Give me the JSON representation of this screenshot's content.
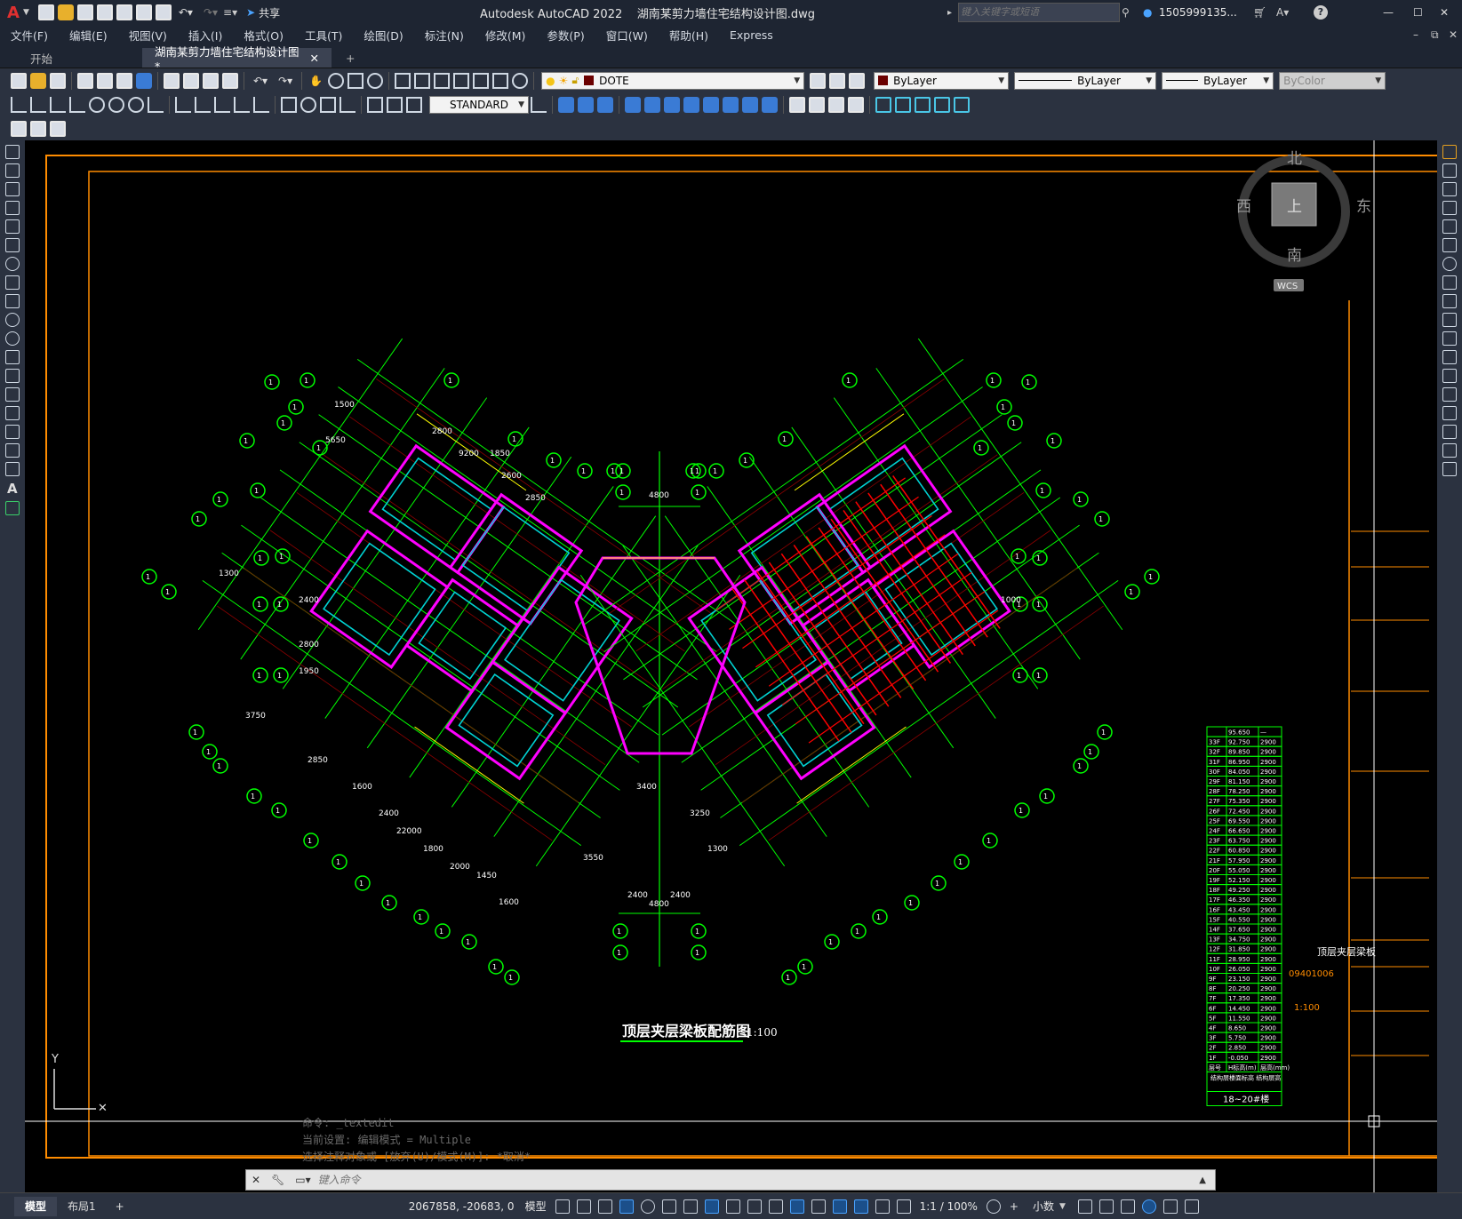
{
  "titlebar": {
    "app_menu": "A",
    "share_label": "共享",
    "title": "Autodesk AutoCAD 2022    湖南某剪力墙住宅结构设计图.dwg",
    "search_placeholder": "键入关键字或短语",
    "user": "1505999135...",
    "help": "?"
  },
  "menu": [
    "文件(F)",
    "编辑(E)",
    "视图(V)",
    "插入(I)",
    "格式(O)",
    "工具(T)",
    "绘图(D)",
    "标注(N)",
    "修改(M)",
    "参数(P)",
    "窗口(W)",
    "帮助(H)",
    "Express"
  ],
  "tabs": [
    {
      "label": "开始",
      "active": false
    },
    {
      "label": "湖南某剪力墙住宅结构设计图*",
      "active": true
    }
  ],
  "toolbar": {
    "layer_name": "DOTE",
    "color": "ByLayer",
    "linetype": "ByLayer",
    "lineweight": "ByLayer",
    "plotstyle": "ByColor",
    "dimstyle": "STANDARD"
  },
  "viewcube": {
    "north": "北",
    "south": "南",
    "east": "东",
    "west": "西",
    "top": "上",
    "wcs": "WCS"
  },
  "drawing": {
    "title": "顶层夹层梁板配筋图",
    "scale": "1:100",
    "dims": [
      "4800",
      "4800",
      "2400",
      "2400",
      "2400",
      "2800",
      "1950",
      "2800",
      "9200",
      "1850",
      "2600",
      "2850",
      "5650",
      "1300",
      "1500",
      "3750",
      "2850",
      "1600",
      "2400",
      "22000",
      "1800",
      "2000",
      "1450",
      "1600",
      "3550",
      "3400",
      "3250",
      "1300",
      "1000"
    ],
    "level_table_title": "结构层楼面标高 结构层高",
    "level_table_footer": "18~20#楼",
    "levels": [
      [
        "",
        "95.650",
        "—"
      ],
      [
        "33F",
        "92.750",
        "2900"
      ],
      [
        "32F",
        "89.850",
        "2900"
      ],
      [
        "31F",
        "86.950",
        "2900"
      ],
      [
        "30F",
        "84.050",
        "2900"
      ],
      [
        "29F",
        "81.150",
        "2900"
      ],
      [
        "28F",
        "78.250",
        "2900"
      ],
      [
        "27F",
        "75.350",
        "2900"
      ],
      [
        "26F",
        "72.450",
        "2900"
      ],
      [
        "25F",
        "69.550",
        "2900"
      ],
      [
        "24F",
        "66.650",
        "2900"
      ],
      [
        "23F",
        "63.750",
        "2900"
      ],
      [
        "22F",
        "60.850",
        "2900"
      ],
      [
        "21F",
        "57.950",
        "2900"
      ],
      [
        "20F",
        "55.050",
        "2900"
      ],
      [
        "19F",
        "52.150",
        "2900"
      ],
      [
        "18F",
        "49.250",
        "2900"
      ],
      [
        "17F",
        "46.350",
        "2900"
      ],
      [
        "16F",
        "43.450",
        "2900"
      ],
      [
        "15F",
        "40.550",
        "2900"
      ],
      [
        "14F",
        "37.650",
        "2900"
      ],
      [
        "13F",
        "34.750",
        "2900"
      ],
      [
        "12F",
        "31.850",
        "2900"
      ],
      [
        "11F",
        "28.950",
        "2900"
      ],
      [
        "10F",
        "26.050",
        "2900"
      ],
      [
        "9F",
        "23.150",
        "2900"
      ],
      [
        "8F",
        "20.250",
        "2900"
      ],
      [
        "7F",
        "17.350",
        "2900"
      ],
      [
        "6F",
        "14.450",
        "2900"
      ],
      [
        "5F",
        "11.550",
        "2900"
      ],
      [
        "4F",
        "8.650",
        "2900"
      ],
      [
        "3F",
        "5.750",
        "2900"
      ],
      [
        "2F",
        "2.850",
        "2900"
      ],
      [
        "1F",
        "-0.050",
        "2900"
      ],
      [
        "层号",
        "H标高(m)",
        "层高(mm)"
      ]
    ],
    "sheet_title": "顶层夹层梁板",
    "sheet_no": "09401006",
    "sheet_scale": "1:100"
  },
  "command": {
    "history": [
      "命令: _textedit",
      "当前设置: 编辑模式 = Multiple",
      "选择注释对象或 [放弃(U)/模式(M)]: *取消*"
    ],
    "placeholder": "键入命令"
  },
  "layout_tabs": [
    "模型",
    "布局1"
  ],
  "status": {
    "coords": "2067858, -20683, 0",
    "space": "模型",
    "scale": "1:1 / 100%",
    "units": "小数"
  },
  "colors": {
    "green": "#00ff00",
    "magenta": "#ff00ff",
    "cyan": "#00d2d2",
    "red": "#ff0000",
    "yellow": "#ffff00",
    "orange": "#ff8c00"
  }
}
